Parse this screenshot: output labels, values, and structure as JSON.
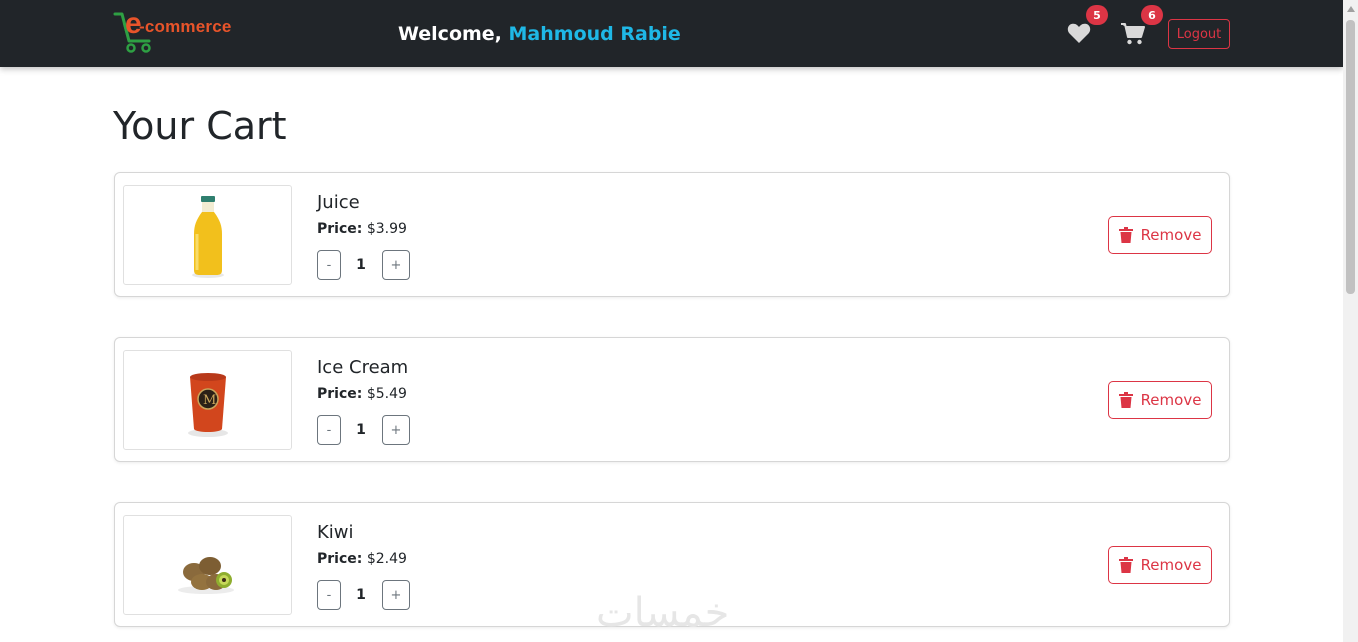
{
  "navbar": {
    "brand_text": "-commerce",
    "brand_letter": "e",
    "welcome_prefix": "Welcome, ",
    "user_name": "Mahmoud Rabie",
    "wishlist_count": "5",
    "cart_count": "6",
    "logout_label": "Logout",
    "icons": {
      "wishlist": "heart-icon",
      "cart": "cart-icon",
      "logo": "shopping-cart-logo-icon"
    }
  },
  "page": {
    "title": "Your Cart"
  },
  "cart": {
    "price_label": "Price:",
    "decrement_label": "-",
    "increment_label": "+",
    "remove_label": "Remove",
    "items": [
      {
        "name": "Juice",
        "price": "$3.99",
        "qty": "1",
        "image": "juice-bottle"
      },
      {
        "name": "Ice Cream",
        "price": "$5.49",
        "qty": "1",
        "image": "ice-cream-tub"
      },
      {
        "name": "Kiwi",
        "price": "$2.49",
        "qty": "1",
        "image": "kiwi-fruits"
      }
    ]
  },
  "watermark": "خمسات",
  "colors": {
    "navbar": "#212529",
    "accent": "#1fb8e6",
    "danger": "#dc3545",
    "brand": "#e8542a"
  }
}
